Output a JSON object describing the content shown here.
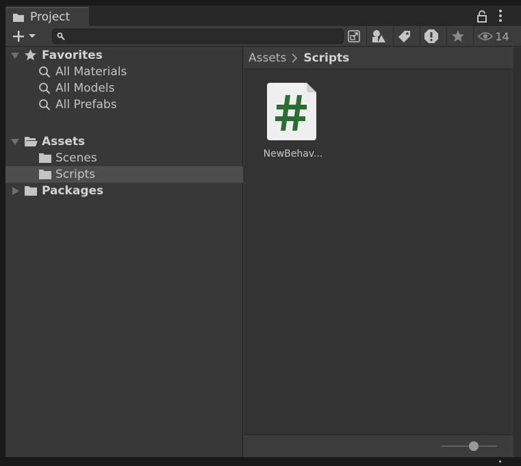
{
  "tab": {
    "title": "Project",
    "icon": "folder-icon"
  },
  "toolbar": {
    "create_icon": "plus-icon",
    "search": {
      "value": "",
      "placeholder": ""
    },
    "hidden_packages_count": "14",
    "icons": [
      "search-icon",
      "open-search-window-icon",
      "search-by-type-icon",
      "search-by-label-icon",
      "console-warning-icon",
      "favorites-star-icon",
      "eye-icon"
    ]
  },
  "tree": {
    "favorites": {
      "label": "Favorites",
      "items": [
        {
          "label": "All Materials"
        },
        {
          "label": "All Models"
        },
        {
          "label": "All Prefabs"
        }
      ]
    },
    "assets": {
      "label": "Assets",
      "children": [
        {
          "label": "Scenes",
          "selected": false
        },
        {
          "label": "Scripts",
          "selected": true
        }
      ]
    },
    "packages": {
      "label": "Packages"
    }
  },
  "breadcrumb": {
    "root": "Assets",
    "current": "Scripts"
  },
  "assets_grid": [
    {
      "label": "NewBehav...",
      "type": "csharp-script",
      "icon_color": "#2a6e33"
    }
  ],
  "colors": {
    "panel": "#383838",
    "content": "#333333",
    "selected": "#4d4d4d",
    "script_icon": "#2a6e33"
  }
}
